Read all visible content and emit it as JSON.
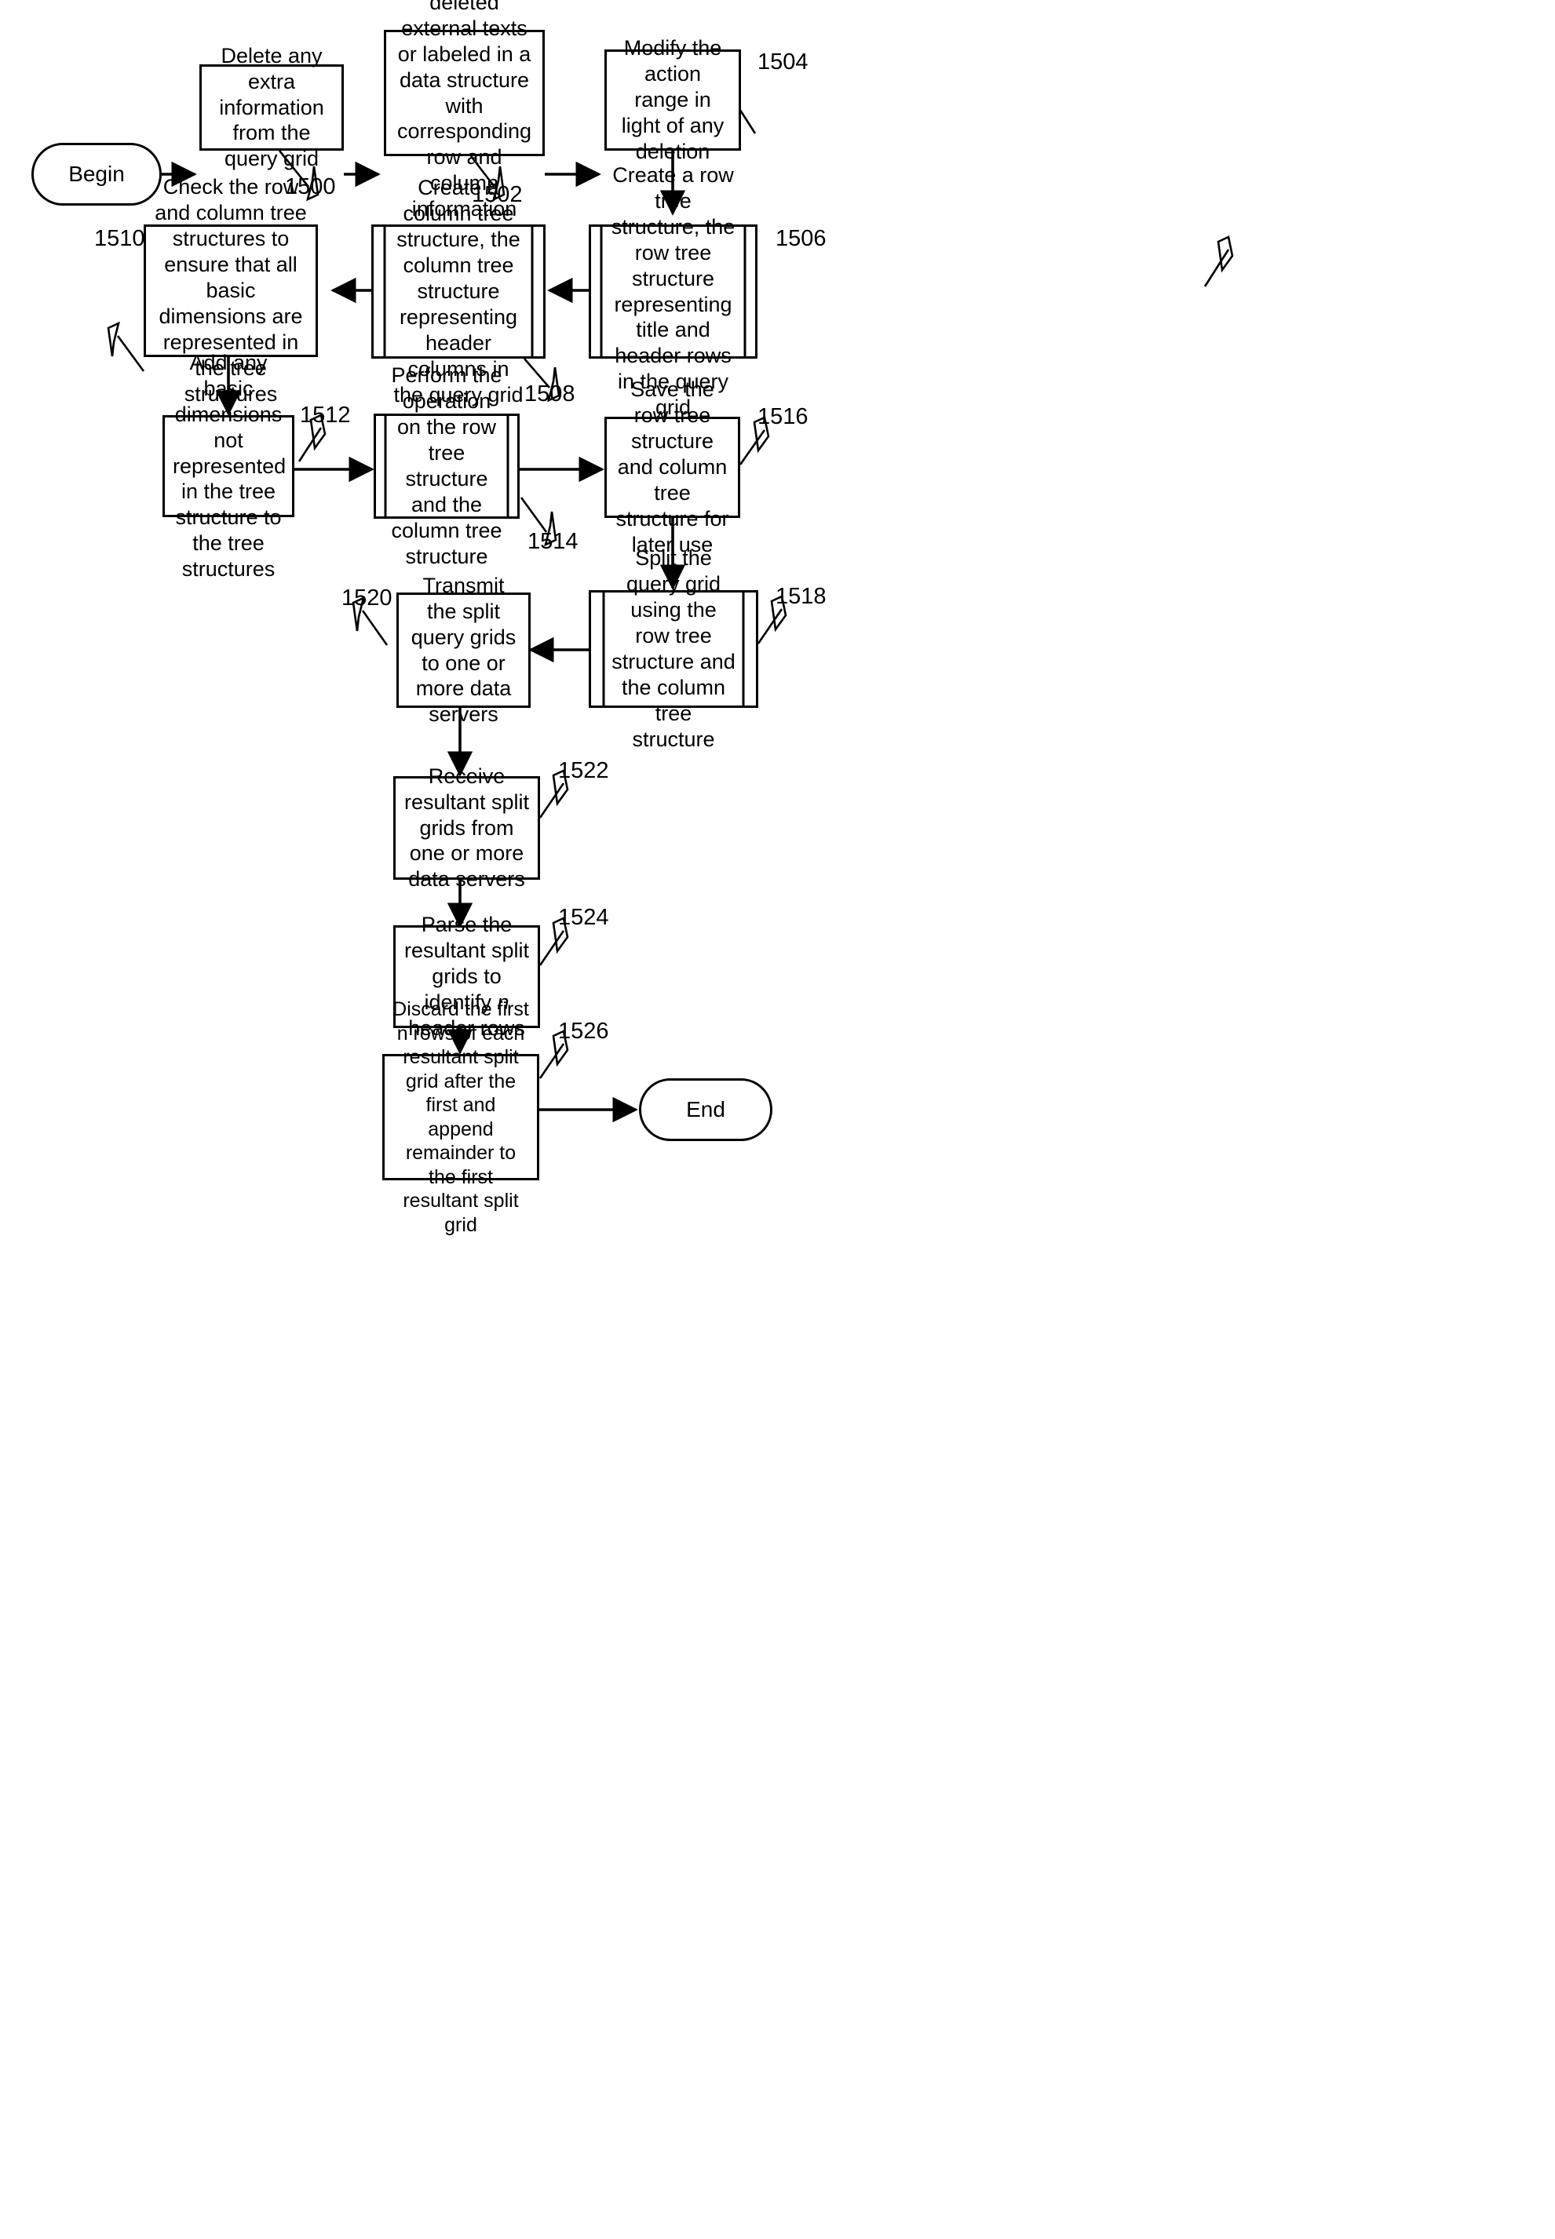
{
  "figure": {
    "type": "flowchart",
    "orientation": "serpentine",
    "background_color": "#ffffff",
    "line_color": "#000000"
  },
  "nodes": {
    "begin": {
      "label": "Begin",
      "shape": "terminator"
    },
    "n1500": {
      "label": "Delete any extra information from the query grid",
      "shape": "process",
      "ref": "1500"
    },
    "n1502": {
      "label": "Save any deleted external texts or labeled in a data structure with corresponding row and column information",
      "shape": "process",
      "ref": "1502"
    },
    "n1504": {
      "label": "Modify the action range in light of any deletion",
      "shape": "process",
      "ref": "1504"
    },
    "n1506": {
      "label": "Create a row tree structure, the row tree structure representing title and header rows in the query grid",
      "shape": "predefined-process",
      "ref": "1506"
    },
    "n1508": {
      "label": "Create a column tree structure, the column tree structure representing header columns in the query grid",
      "shape": "predefined-process",
      "ref": "1508"
    },
    "n1510": {
      "label": "Check the row and column tree structures to ensure that all basic dimensions are represented in the tree structures",
      "shape": "process",
      "ref": "1510"
    },
    "n1512": {
      "label": "Add any basic dimensions not represented in the tree structure to the tree structures",
      "shape": "process",
      "ref": "1512"
    },
    "n1514": {
      "label": "Perform the operation on the row tree structure and the column tree structure",
      "shape": "predefined-process",
      "ref": "1514"
    },
    "n1516": {
      "label": "Save the row tree structure and column tree structure for later use",
      "shape": "process",
      "ref": "1516"
    },
    "n1518": {
      "label": "Split the query grid using the row tree structure and the column tree structure",
      "shape": "predefined-process",
      "ref": "1518"
    },
    "n1520": {
      "label": "Transmit the split query grids to one or more data servers",
      "shape": "process",
      "ref": "1520"
    },
    "n1522": {
      "label": "Receive resultant split grids from one or more data servers",
      "shape": "process",
      "ref": "1522"
    },
    "n1524": {
      "label_pre": "Parse the resultant split grids to identify ",
      "label_italic": "n",
      "label_post": " header rows",
      "shape": "process",
      "ref": "1524"
    },
    "n1526": {
      "label": "Discard the first n rows of each resultant split grid after the first and append remainder to the first resultant split grid",
      "shape": "process",
      "ref": "1526"
    },
    "end": {
      "label": "End",
      "shape": "terminator"
    }
  },
  "reference_numerals": {
    "r1500": "1500",
    "r1502": "1502",
    "r1504": "1504",
    "r1506": "1506",
    "r1508": "1508",
    "r1510": "1510",
    "r1512": "1512",
    "r1514": "1514",
    "r1516": "1516",
    "r1518": "1518",
    "r1520": "1520",
    "r1522": "1522",
    "r1524": "1524",
    "r1526": "1526"
  },
  "flow_edges": [
    {
      "from": "begin",
      "to": "n1500",
      "direction": "right"
    },
    {
      "from": "n1500",
      "to": "n1502",
      "direction": "right"
    },
    {
      "from": "n1502",
      "to": "n1504",
      "direction": "right"
    },
    {
      "from": "n1504",
      "to": "n1506",
      "direction": "down"
    },
    {
      "from": "n1506",
      "to": "n1508",
      "direction": "left"
    },
    {
      "from": "n1508",
      "to": "n1510",
      "direction": "left"
    },
    {
      "from": "n1510",
      "to": "n1512",
      "direction": "down"
    },
    {
      "from": "n1512",
      "to": "n1514",
      "direction": "right"
    },
    {
      "from": "n1514",
      "to": "n1516",
      "direction": "right"
    },
    {
      "from": "n1516",
      "to": "n1518",
      "direction": "down"
    },
    {
      "from": "n1518",
      "to": "n1520",
      "direction": "left"
    },
    {
      "from": "n1520",
      "to": "n1522",
      "direction": "down"
    },
    {
      "from": "n1522",
      "to": "n1524",
      "direction": "down"
    },
    {
      "from": "n1524",
      "to": "n1526",
      "direction": "down"
    },
    {
      "from": "n1526",
      "to": "end",
      "direction": "right"
    }
  ]
}
